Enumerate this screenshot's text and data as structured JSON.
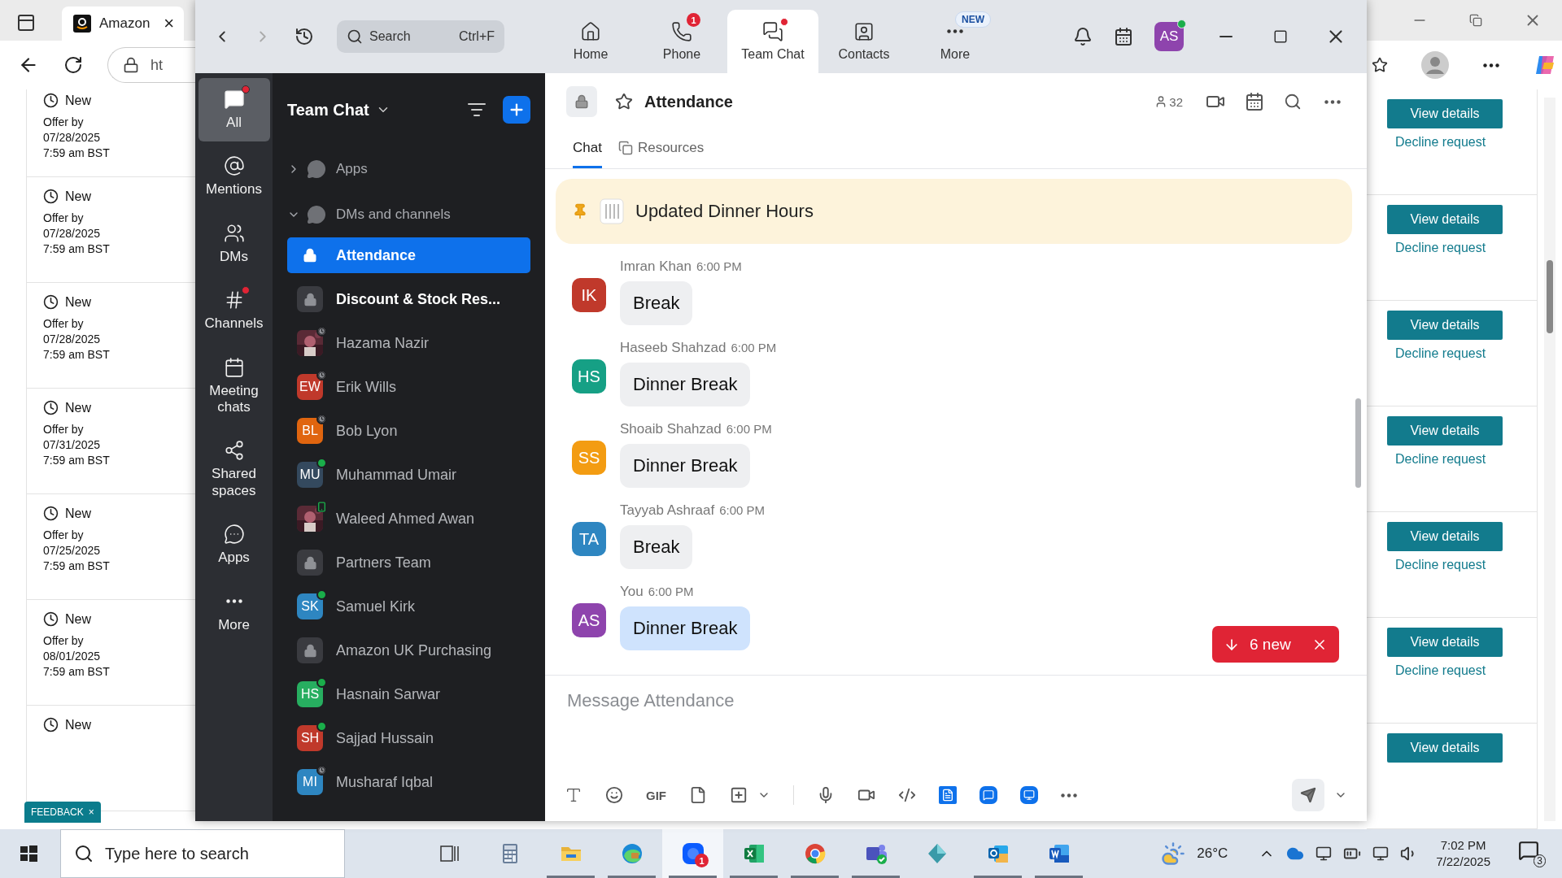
{
  "browser": {
    "tab_title": "Amazon",
    "tab_close": "×",
    "address_fragment": "ht",
    "feedback": "FEEDBACK",
    "feedback_close": "×",
    "listings": [
      {
        "status": "New",
        "offer_label": "Offer by",
        "date": "07/28/2025",
        "time": "7:59 am BST",
        "view_button": "View details",
        "decline_link": "Decline request"
      },
      {
        "status": "New",
        "offer_label": "Offer by",
        "date": "07/28/2025",
        "time": "7:59 am BST",
        "view_button": "View details",
        "decline_link": "Decline request"
      },
      {
        "status": "New",
        "offer_label": "Offer by",
        "date": "07/28/2025",
        "time": "7:59 am BST",
        "view_button": "View details",
        "decline_link": "Decline request"
      },
      {
        "status": "New",
        "offer_label": "Offer by",
        "date": "07/31/2025",
        "time": "7:59 am BST",
        "view_button": "View details",
        "decline_link": "Decline request"
      },
      {
        "status": "New",
        "offer_label": "Offer by",
        "date": "07/25/2025",
        "time": "7:59 am BST",
        "view_button": "View details",
        "decline_link": "Decline request"
      },
      {
        "status": "New",
        "offer_label": "Offer by",
        "date": "08/01/2025",
        "time": "7:59 am BST",
        "view_button": "View details",
        "decline_link": "Decline request"
      },
      {
        "status": "New",
        "view_button": "View details"
      }
    ]
  },
  "top_bar": {
    "search": {
      "placeholder": "Search",
      "shortcut": "Ctrl+F"
    },
    "tabs": [
      {
        "label": "Home",
        "selected": false
      },
      {
        "label": "Phone",
        "selected": false,
        "badge": "1"
      },
      {
        "label": "Team Chat",
        "selected": true,
        "dot": true
      },
      {
        "label": "Contacts",
        "selected": false
      },
      {
        "label": "More",
        "selected": false,
        "tag": "NEW"
      }
    ],
    "user": {
      "initials": "AS",
      "online": true
    }
  },
  "nav": [
    {
      "label": "All",
      "selected": true,
      "dot": true
    },
    {
      "label": "Mentions",
      "selected": false,
      "dot": false
    },
    {
      "label": "DMs",
      "selected": false,
      "dot": false
    },
    {
      "label": "Channels",
      "selected": false,
      "dot": true
    },
    {
      "label": "Meeting chats",
      "selected": false,
      "dot": false
    },
    {
      "label": "Shared spaces",
      "selected": false,
      "dot": false
    },
    {
      "label": "Apps",
      "selected": false,
      "dot": false
    },
    {
      "label": "More",
      "selected": false,
      "dot": false
    }
  ],
  "channel_list": {
    "title": "Team Chat",
    "sections": [
      {
        "label": "Apps",
        "expanded": false
      },
      {
        "label": "DMs and channels",
        "expanded": true
      }
    ],
    "items": [
      {
        "kind": "channel",
        "name": "Attendance",
        "selected": true,
        "unread": false
      },
      {
        "kind": "channel",
        "name": "Discount & Stock Res...",
        "selected": false,
        "unread": true
      },
      {
        "name": "Hazama Nazir",
        "selected": false,
        "unread": false,
        "presence": {
          "kind": "away"
        }
      },
      {
        "kind": "person",
        "name": "Erik Wills",
        "initials": "EW",
        "color": "#c0392b",
        "selected": false,
        "unread": false,
        "presence": {
          "kind": "away"
        }
      },
      {
        "kind": "person",
        "name": "Bob Lyon",
        "initials": "BL",
        "color": "#e0650f",
        "selected": false,
        "unread": false,
        "presence": {
          "kind": "away"
        }
      },
      {
        "kind": "person",
        "name": "Muhammad Umair",
        "initials": "MU",
        "color": "#34495e",
        "selected": false,
        "unread": false,
        "presence": {
          "kind": "online"
        }
      },
      {
        "name": "Waleed Ahmed Awan",
        "selected": false,
        "unread": false,
        "presence": {
          "kind": "mobile"
        }
      },
      {
        "kind": "channel",
        "name": "Partners Team",
        "selected": false,
        "unread": false
      },
      {
        "kind": "person",
        "name": "Samuel Kirk",
        "initials": "SK",
        "color": "#2e86c1",
        "selected": false,
        "unread": false,
        "presence": {
          "kind": "online"
        }
      },
      {
        "kind": "channel",
        "name": "Amazon UK Purchasing",
        "selected": false,
        "unread": false
      },
      {
        "kind": "person",
        "name": "Hasnain Sarwar",
        "initials": "HS",
        "color": "#27ae60",
        "selected": false,
        "unread": false,
        "presence": {
          "kind": "online"
        }
      },
      {
        "kind": "person",
        "name": "Sajjad Hussain",
        "initials": "SH",
        "color": "#c0392b",
        "selected": false,
        "unread": false,
        "presence": {
          "kind": "online"
        }
      },
      {
        "kind": "person",
        "name": "Musharaf Iqbal",
        "initials": "MI",
        "color": "#2e86c1",
        "selected": false,
        "unread": false,
        "presence": {
          "kind": "away"
        }
      }
    ]
  },
  "chat": {
    "title": "Attendance",
    "member_count": "32",
    "tabs": [
      {
        "label": "Chat",
        "selected": true
      },
      {
        "label": "Resources",
        "selected": false
      }
    ],
    "pinned": "Updated Dinner Hours",
    "messages": [
      {
        "sender": "Imran Khan",
        "time": "6:00 PM",
        "text": "Break",
        "initials": "IK",
        "color": "#c0392b",
        "own": false
      },
      {
        "sender": "Haseeb Shahzad",
        "time": "6:00 PM",
        "text": "Dinner Break",
        "initials": "HS",
        "color": "#16a085",
        "own": false
      },
      {
        "sender": "Shoaib Shahzad",
        "time": "6:00 PM",
        "text": "Dinner Break",
        "initials": "SS",
        "color": "#f39c12",
        "own": false
      },
      {
        "sender": "Tayyab Ashraaf",
        "time": "6:00 PM",
        "text": "Break",
        "initials": "TA",
        "color": "#2e86c1",
        "own": false
      },
      {
        "sender": "You",
        "time": "6:00 PM",
        "text": "Dinner Break",
        "initials": "AS",
        "color": "#8e44ad",
        "own": true
      }
    ],
    "new_messages": "6 new",
    "composer": {
      "placeholder": "Message Attendance",
      "gif": "GIF"
    }
  },
  "taskbar": {
    "search_placeholder": "Type here to search",
    "apps": [
      {
        "kind": "taskview",
        "running": false,
        "selected": false
      },
      {
        "kind": "calculator",
        "running": false,
        "selected": false
      },
      {
        "kind": "explorer",
        "running": true,
        "selected": false
      },
      {
        "kind": "edge",
        "running": true,
        "selected": false
      },
      {
        "kind": "zoom",
        "running": true,
        "selected": true,
        "badge": "1"
      },
      {
        "kind": "excel",
        "running": true,
        "selected": false
      },
      {
        "kind": "chrome",
        "running": true,
        "selected": false
      },
      {
        "kind": "teams",
        "running": true,
        "selected": false
      },
      {
        "kind": "app",
        "running": false,
        "selected": false
      },
      {
        "kind": "outlook",
        "running": true,
        "selected": false
      },
      {
        "kind": "word",
        "running": true,
        "selected": false
      }
    ],
    "temperature": "26°C",
    "time": "7:02 PM",
    "date": "7/22/2025",
    "notifications": "3"
  }
}
